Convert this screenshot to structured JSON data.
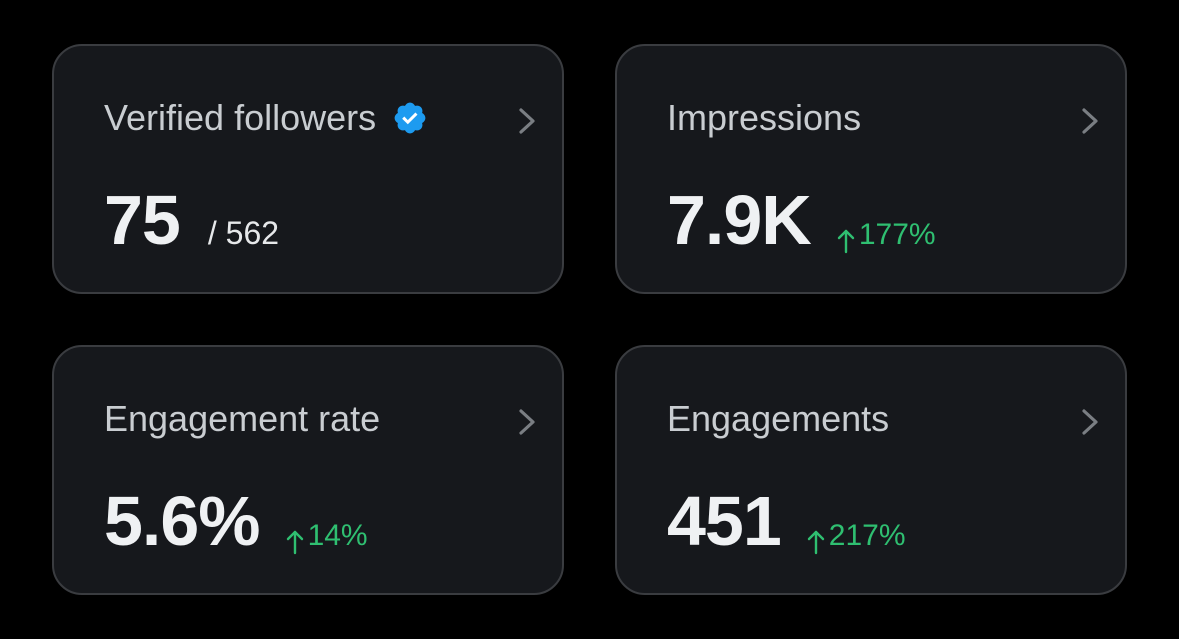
{
  "cards": [
    {
      "title": "Verified followers",
      "value": "75",
      "sub": "/ 562",
      "icon": "verified-badge-icon"
    },
    {
      "title": "Impressions",
      "value": "7.9K",
      "delta": "177%"
    },
    {
      "title": "Engagement rate",
      "value": "5.6%",
      "delta": "14%"
    },
    {
      "title": "Engagements",
      "value": "451",
      "delta": "217%"
    }
  ],
  "colors": {
    "background": "#000000",
    "card": "#16181c",
    "border": "#3a3c40",
    "title": "#c9cdd1",
    "value": "#eff1f3",
    "positive": "#2fbf71",
    "verified": "#1d9bf0"
  }
}
